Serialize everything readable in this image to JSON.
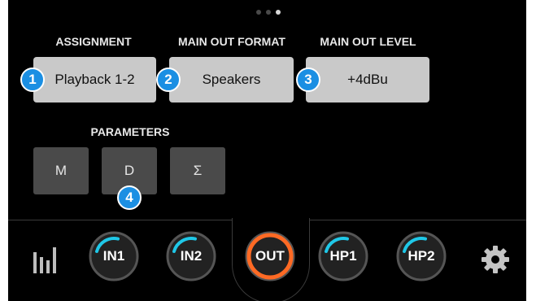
{
  "page_dots": {
    "count": 3,
    "active_index": 2
  },
  "headers": {
    "assignment": "ASSIGNMENT",
    "main_out_format": "MAIN OUT FORMAT",
    "main_out_level": "MAIN OUT LEVEL",
    "parameters": "PARAMETERS"
  },
  "buttons": {
    "assignment": "Playback 1-2",
    "format": "Speakers",
    "level": "+4dBu"
  },
  "markers": [
    "1",
    "2",
    "3",
    "4"
  ],
  "parameters": [
    "M",
    "D",
    "Σ"
  ],
  "nav": {
    "meters_icon": "meters-icon",
    "knobs": [
      {
        "label": "IN1",
        "ring": "#1fc8e8"
      },
      {
        "label": "IN2",
        "ring": "#1fc8e8"
      },
      {
        "label": "OUT",
        "ring": "#ff6a24"
      },
      {
        "label": "HP1",
        "ring": "#1fc8e8"
      },
      {
        "label": "HP2",
        "ring": "#1fc8e8"
      }
    ],
    "settings_icon": "gear-icon"
  }
}
